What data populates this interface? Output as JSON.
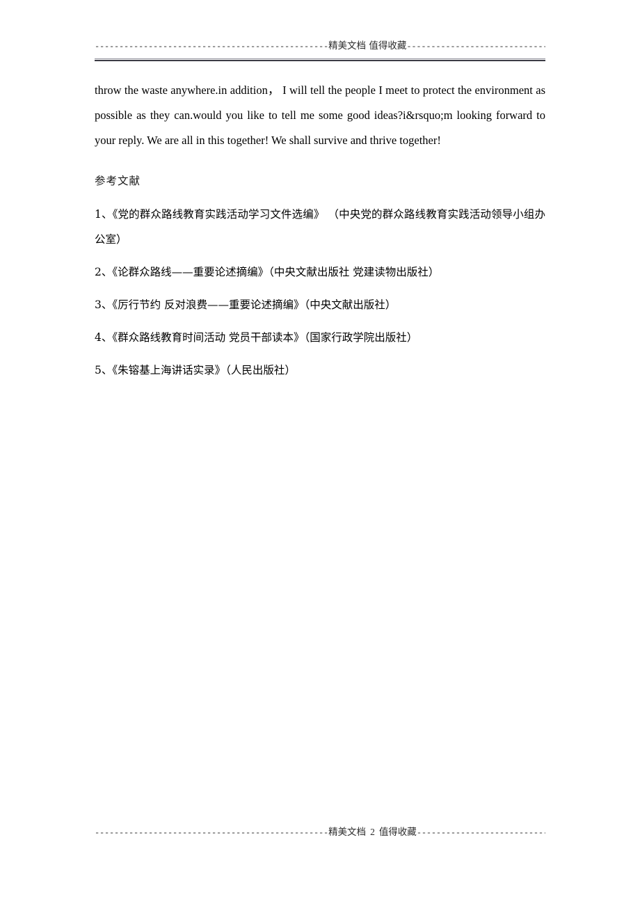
{
  "header": {
    "dashes_left": "------------------------------------------------",
    "title": "精美文档  值得收藏",
    "dashes_right": "-----------------------------------------------"
  },
  "body": {
    "paragraph": "throw the waste anywhere.in    addition，    I will tell the people I meet to protect the environment  as  possible      as  they  can.would  you  like  to  tell  me  some  good  ideas?i&rsquo;m  looking  forward  to     your reply. We are all in this together! We shall survive and thrive    together!",
    "references_heading": "参考文献",
    "references": [
      "1、《党的群众路线教育实践活动学习文件选编》  （中央党的群众路线教育实践活动领导小组办公室）",
      "2、《论群众路线——重要论述摘编》（中央文献出版社  党建读物出版社）",
      "3、《厉行节约  反对浪费——重要论述摘编》（中央文献出版社）",
      "4、《群众路线教育时间活动  党员干部读本》（国家行政学院出版社）",
      "5、《朱镕基上海讲话实录》（人民出版社）"
    ]
  },
  "footer": {
    "dashes_left": "------------------------------------------------",
    "title_left": "精美文档",
    "page_number": "2",
    "title_right": "值得收藏",
    "dashes_right": "------------------------------------------------"
  }
}
